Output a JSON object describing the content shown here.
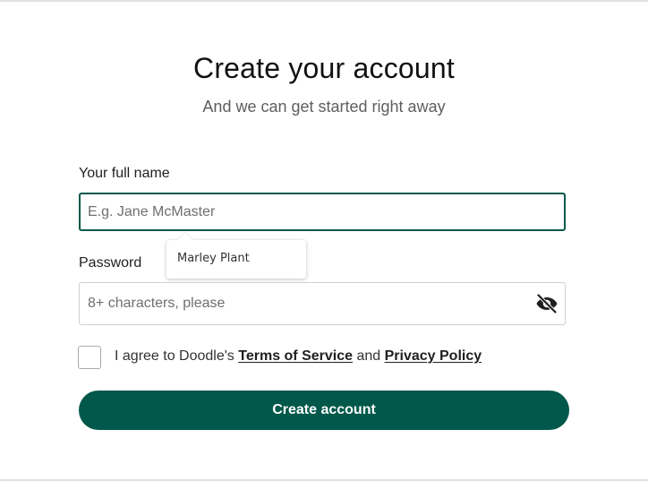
{
  "header": {
    "title": "Create your account",
    "subtitle": "And we can get started right away"
  },
  "form": {
    "name_label": "Your full name",
    "name_placeholder": "E.g. Jane McMaster",
    "name_value": "",
    "autocomplete_suggestion": "Marley Plant",
    "password_label": "Password",
    "password_placeholder": "8+ characters, please",
    "password_value": "",
    "password_toggle_icon": "eye-slash-icon",
    "agree_prefix": "I agree to Doodle's ",
    "terms_link": "Terms of Service",
    "agree_and": " and ",
    "privacy_link": "Privacy Policy",
    "submit_label": "Create account"
  },
  "colors": {
    "brand": "#00584a",
    "text": "#1f1f1f",
    "muted": "#5e5e5e",
    "border": "#cfcfcf"
  }
}
